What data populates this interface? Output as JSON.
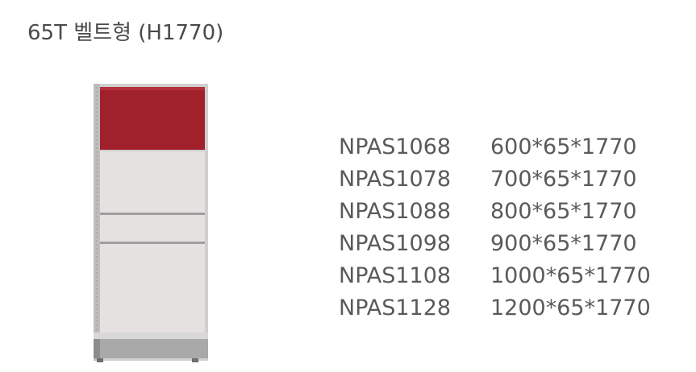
{
  "title": "65T 벨트형 (H1770)",
  "specs": [
    {
      "code": "NPAS1068",
      "dimension": "600*65*1770"
    },
    {
      "code": "NPAS1078",
      "dimension": "700*65*1770"
    },
    {
      "code": "NPAS1088",
      "dimension": "800*65*1770"
    },
    {
      "code": "NPAS1098",
      "dimension": "900*65*1770"
    },
    {
      "code": "NPAS1108",
      "dimension": "1000*65*1770"
    },
    {
      "code": "NPAS1128",
      "dimension": "1200*65*1770"
    }
  ],
  "colors": {
    "red_panel": "#a0202b",
    "light_panel": "#e6e1e1",
    "frame": "#c6c6c6",
    "base": "#a9a9a9"
  }
}
